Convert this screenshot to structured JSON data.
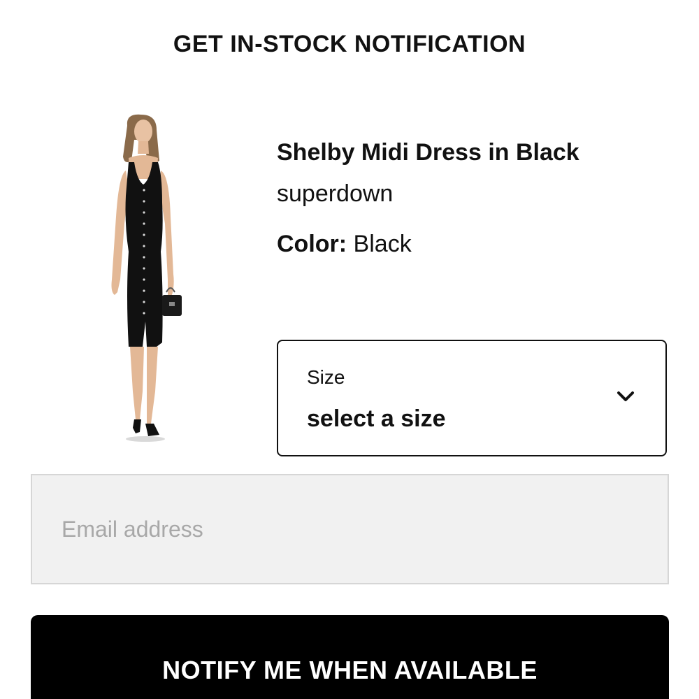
{
  "header": {
    "title": "GET IN-STOCK NOTIFICATION"
  },
  "product": {
    "name": "Shelby Midi Dress in Black",
    "brand": "superdown",
    "color_label": "Color:",
    "color_value": "Black",
    "image_icon": "dress-model-photo"
  },
  "size_select": {
    "label": "Size",
    "value": "select a size",
    "icon": "chevron-down-icon"
  },
  "email": {
    "placeholder": "Email address",
    "value": ""
  },
  "notify_button": {
    "label": "NOTIFY ME WHEN AVAILABLE"
  },
  "colors": {
    "text": "#111111",
    "button_bg": "#000000",
    "button_text": "#ffffff",
    "input_bg": "#f1f1f1",
    "input_border": "#d6d6d6",
    "placeholder": "#a8a8a8"
  }
}
